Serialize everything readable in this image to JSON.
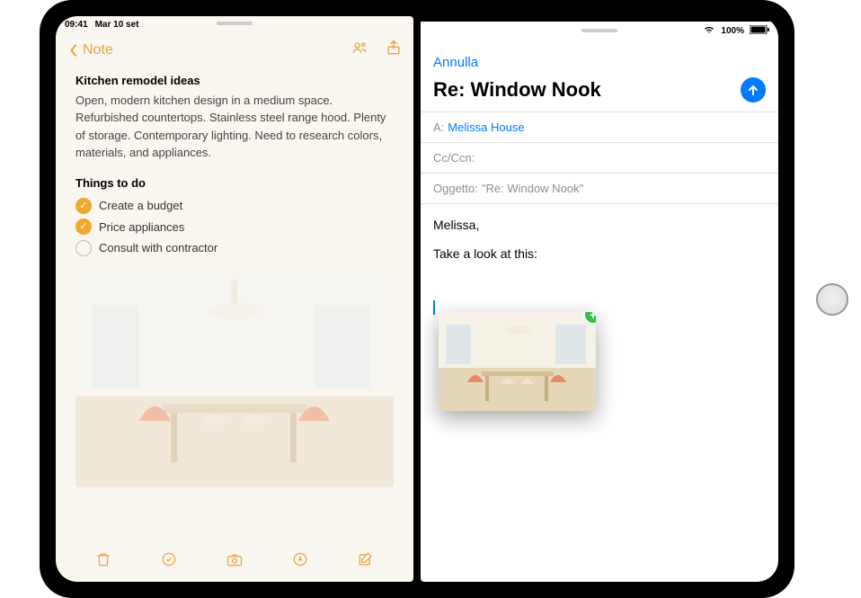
{
  "status": {
    "time": "09:41",
    "date": "Mar 10 set",
    "battery": "100%"
  },
  "notes": {
    "back_label": "Note",
    "title": "Kitchen remodel ideas",
    "body": "Open, modern kitchen design in a medium space. Refurbished countertops. Stainless steel range hood. Plenty of storage. Contemporary lighting. Need to research colors, materials, and appliances.",
    "todo_header": "Things to do",
    "todos": [
      {
        "label": "Create a budget",
        "done": true
      },
      {
        "label": "Price appliances",
        "done": true
      },
      {
        "label": "Consult with contractor",
        "done": false
      }
    ],
    "icons": {
      "collaborate": "collaborate-icon",
      "share": "share-icon",
      "trash": "trash-icon",
      "checklist": "checklist-icon",
      "camera": "camera-icon",
      "markup": "markup-icon",
      "compose": "compose-icon"
    }
  },
  "mail": {
    "cancel_label": "Annulla",
    "subject_display": "Re:  Window Nook",
    "to_label": "A:",
    "to_recipient": "Melissa House",
    "cc_label": "Cc/Ccn:",
    "subject_label": "Oggetto:",
    "subject_value": "\"Re:  Window Nook\"",
    "body_line1": "Melissa,",
    "body_line2": "Take a look at this:"
  },
  "colors": {
    "notes_accent": "#e8a33d",
    "mail_accent": "#007aff",
    "add_badge": "#30c048"
  }
}
